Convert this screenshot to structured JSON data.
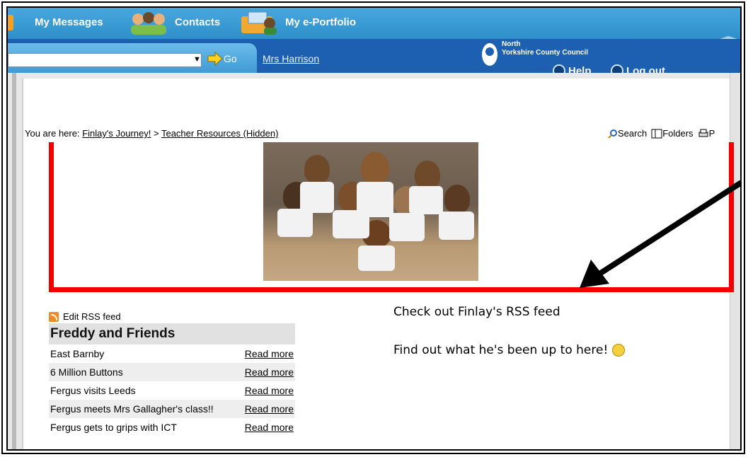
{
  "nav": {
    "my_messages": "My Messages",
    "contacts": "Contacts",
    "my_eportfolio": "My e-Portfolio"
  },
  "search": {
    "go_label": "Go",
    "user_link": "Mrs Harrison"
  },
  "council": {
    "line1": "North",
    "line2": "Yorkshire County Council",
    "help": "Help",
    "logout": "Log out"
  },
  "breadcrumb": {
    "prefix": "You are here:",
    "item1": "Finlay's Journey!",
    "sep": ">",
    "item2": "Teacher Resources (Hidden)"
  },
  "tools": {
    "search": "Search",
    "folders": "Folders",
    "print": "P"
  },
  "rss": {
    "edit_label": "Edit RSS feed",
    "feed_title": "Freddy and Friends",
    "items": [
      {
        "title": "East Barnby",
        "link": "Read more"
      },
      {
        "title": "6 Million Buttons",
        "link": "Read more"
      },
      {
        "title": "Fergus visits Leeds",
        "link": "Read more"
      },
      {
        "title": "Fergus meets Mrs Gallagher's class!!",
        "link": "Read more"
      },
      {
        "title": "Fergus gets to grips with ICT",
        "link": "Read more"
      }
    ]
  },
  "message": {
    "line1": "Check out Finlay's RSS feed",
    "line2": "Find out what he's been up to here!"
  },
  "colors": {
    "nav_blue": "#3a9bd3",
    "dark_blue": "#1d5fb0",
    "highlight_red": "#f20000"
  }
}
